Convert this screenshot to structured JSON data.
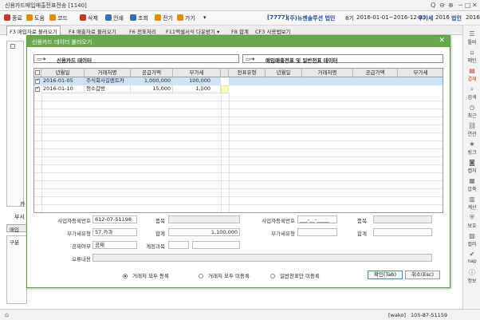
{
  "window": {
    "title": "신용카드매입매출전표전송 [1140]",
    "controls": [
      "─",
      "□",
      "✕"
    ],
    "top_icons": [
      "Q",
      "⊖",
      "⊕"
    ]
  },
  "toolbar": {
    "items": [
      {
        "label": "종료",
        "color": "#c0392b"
      },
      {
        "label": "도움",
        "color": "#e08a00"
      },
      {
        "label": "코드",
        "color": "#e08a00"
      },
      {
        "label": "삭제",
        "color": "#c0392b"
      },
      {
        "label": "인쇄",
        "color": "#3b6db3"
      },
      {
        "label": "조회",
        "color": "#3b6db3"
      },
      {
        "label": "전기",
        "color": "#e08a00"
      },
      {
        "label": "가기",
        "color": "#e08a00"
      }
    ],
    "more": "▾",
    "company_code": "[7777]",
    "company_name": "(주)뉴젠솔루션 법인",
    "period_no": "8기",
    "period": "2016-01-01~2016-12-31",
    "vat_label": "부가세",
    "vat_year": "2016",
    "tax_label": "법인",
    "tax_year": "2016"
  },
  "menubar": {
    "items": [
      "F3 매입자료 불러오기",
      "F4 매출자료 불러오기",
      "F6 전표처리",
      "F11엑셀서식 다운받기 ▾",
      "F8 합계",
      "CF3 사용법보기"
    ]
  },
  "sidepanel": {
    "items": [
      {
        "icon": "☰",
        "label": "툴바"
      },
      {
        "icon": "⌂",
        "label": "메인"
      },
      {
        "icon": "▤",
        "label": "결재",
        "red": true
      },
      {
        "icon": "⌕",
        "label": "검색"
      },
      {
        "icon": "◷",
        "label": "최근"
      },
      {
        "icon": "⛓",
        "label": "연관"
      },
      {
        "icon": "★",
        "label": "링크"
      },
      {
        "icon": "◙",
        "label": "캡처"
      },
      {
        "icon": "▦",
        "label": "압축"
      },
      {
        "icon": "▥",
        "label": "계산"
      },
      {
        "icon": "⛨",
        "label": "보호"
      },
      {
        "icon": "▧",
        "label": "컬러"
      },
      {
        "icon": "✔",
        "label": "nap"
      },
      {
        "icon": "ⓘ",
        "label": "정보"
      }
    ]
  },
  "dialog": {
    "title": "신용카드 데이터 불러오기",
    "close": "✕",
    "left_section": "신용카드 데이터",
    "right_section": "매입매출전표 및 일반전표 데이터",
    "arrow": "▭➔",
    "grid": {
      "left_headers": [
        "년월일",
        "거래처명",
        "공급가액",
        "부가세"
      ],
      "right_headers": [
        "전표유형",
        "년월일",
        "거래처명",
        "공급가액",
        "부가세"
      ],
      "rows": [
        {
          "date": "2016-01-05",
          "vendor": "주식회사길렌트카",
          "supply": "1,000,000",
          "vat": "100,000",
          "checked": true,
          "selected": true
        },
        {
          "date": "2016-01-10",
          "vendor": "청소갑방",
          "supply": "15,000",
          "vat": "1,500",
          "checked": true,
          "selected": false
        }
      ]
    },
    "form": {
      "bizno_label": "사업자등록번호",
      "bizno_value": "612-07-51198",
      "reg_label": "품목",
      "right_bizno_label": "사업자등록번호",
      "right_bizno_value": "___-__-_____",
      "right_reg_label": "품목",
      "vat_type_label": "부가세유형",
      "vat_type_value": "57.카과",
      "sum_label": "합계",
      "sum_value": "1,100,000",
      "right_vat_type_label": "부가세유형",
      "right_sum_label": "합계",
      "deduct_label": "공제여부",
      "deduct_value": "공제",
      "account_label": "계정과목",
      "error_label": "오류내용"
    },
    "radios": [
      "거래처 모두 등록",
      "거래처 모두 미등록",
      "일반전표만 미등록"
    ],
    "ok_button": "확인(Tab)",
    "cancel_button": "취소(Esc)"
  },
  "background": {
    "card_label": "카",
    "vat_label": "부서",
    "tab_label": "매입",
    "col_label": "구분"
  },
  "status": {
    "user": "[wako]",
    "bizno": "105-87-51159"
  }
}
